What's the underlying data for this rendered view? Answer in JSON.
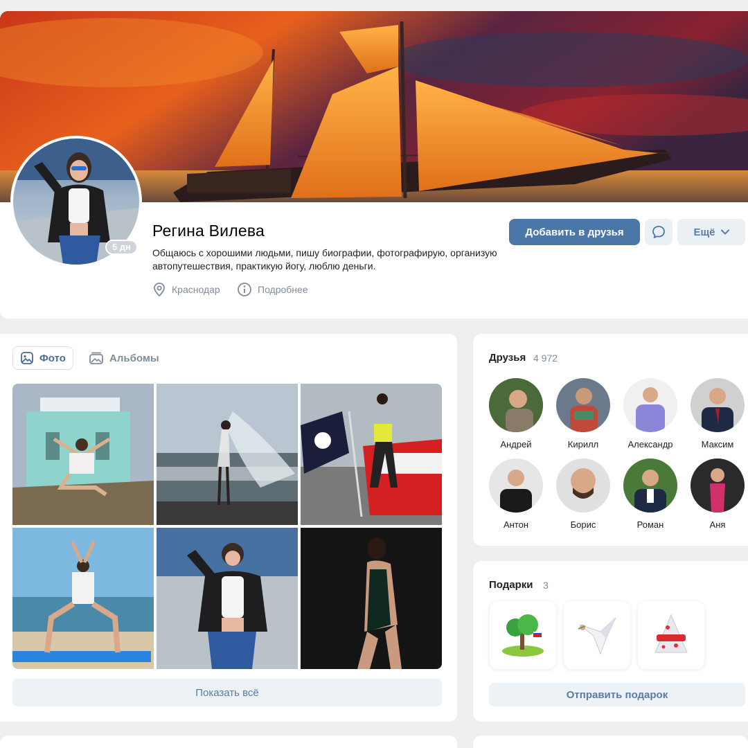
{
  "profile": {
    "name": "Регина Вилева",
    "status": "Общаюсь с хорошими людьми, пишу биографии, фотографирую, организую автопутешествия, практикую йогу, люблю деньги.",
    "last_seen": "5 дн",
    "city": "Краснодар",
    "details_link": "Подробнее",
    "avatar_icon": "person-photo-icon",
    "cover_icon": "sailing-ship-sunset-cover"
  },
  "actions": {
    "add_friend": "Добавить в друзья",
    "message_icon": "chat-bubble-icon",
    "more": "Ещё",
    "more_icon": "chevron-down-icon"
  },
  "photos": {
    "tabs": [
      {
        "label": "Фото",
        "icon": "photo-icon",
        "active": true
      },
      {
        "label": "Альбомы",
        "icon": "albums-icon",
        "active": false
      }
    ],
    "show_all": "Показать всё"
  },
  "friends": {
    "title": "Друзья",
    "count": "4 972",
    "items": [
      {
        "name": "Андрей"
      },
      {
        "name": "Кирилл"
      },
      {
        "name": "Александр"
      },
      {
        "name": "Максим"
      },
      {
        "name": "Антон"
      },
      {
        "name": "Борис"
      },
      {
        "name": "Роман"
      },
      {
        "name": "Аня"
      }
    ]
  },
  "gifts": {
    "title": "Подарки",
    "count": "3",
    "items": [
      {
        "icon": "island-tree-gift-icon"
      },
      {
        "icon": "origami-bird-gift-icon"
      },
      {
        "icon": "christmas-tree-gift-icon"
      }
    ],
    "send": "Отправить подарок"
  },
  "colors": {
    "accent": "#4a76a8",
    "secondary_text": "#818c99",
    "page_bg": "#edeef0",
    "button_light_bg": "#ebf0f5",
    "button_light_text": "#5a7ba3"
  }
}
